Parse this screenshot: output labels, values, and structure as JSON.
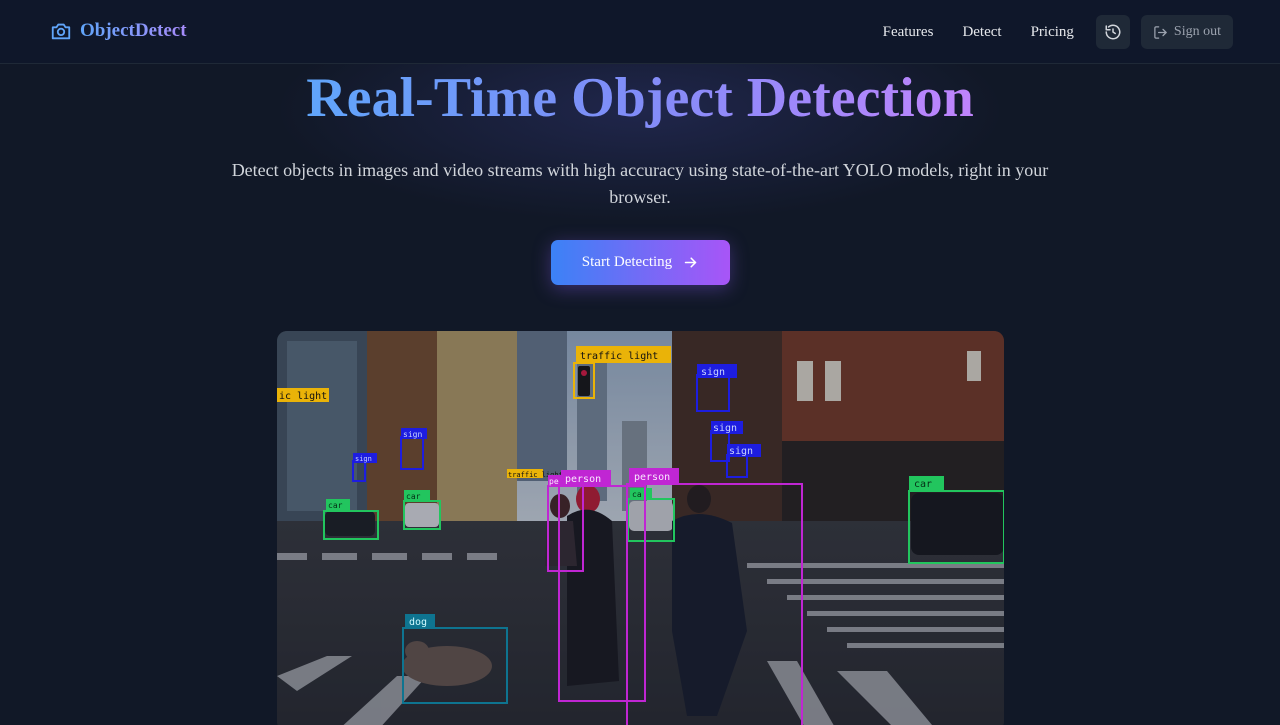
{
  "nav": {
    "brand": "ObjectDetect",
    "links": [
      "Features",
      "Detect",
      "Pricing"
    ],
    "history_icon": "history-icon",
    "signout_label": "Sign out",
    "signout_icon": "sign-out-icon"
  },
  "hero": {
    "title": "Real-Time Object Detection",
    "subtitle": "Detect objects in images and video streams with high accuracy using state-of-the-art YOLO models, right in your browser.",
    "cta_label": "Start Detecting",
    "cta_icon": "arrow-right-icon"
  },
  "demo": {
    "labels": {
      "traffic_light": "traffic light",
      "traffic_light_left": "ic light",
      "traffic_light_small": "traffic light",
      "person1": "person",
      "person2": "person",
      "person3": "pe",
      "car1": "car",
      "car2": "car",
      "car3": "car",
      "car4": "ca",
      "dog": "dog",
      "sign1": "sign",
      "sign2": "sign",
      "sign3": "sign",
      "sign4": "sign",
      "sign5": "sign"
    }
  },
  "colors": {
    "background": "#111827",
    "brand_gradient_start": "#60a5fa",
    "brand_gradient_end": "#a78bfa",
    "cta_start": "#3b82f6",
    "cta_end": "#a855f7",
    "person_box": "#c026d3",
    "car_box": "#22c55e",
    "traffic_light_box": "#eab308",
    "sign_box": "#1d1de0",
    "dog_box": "#0e7490"
  }
}
